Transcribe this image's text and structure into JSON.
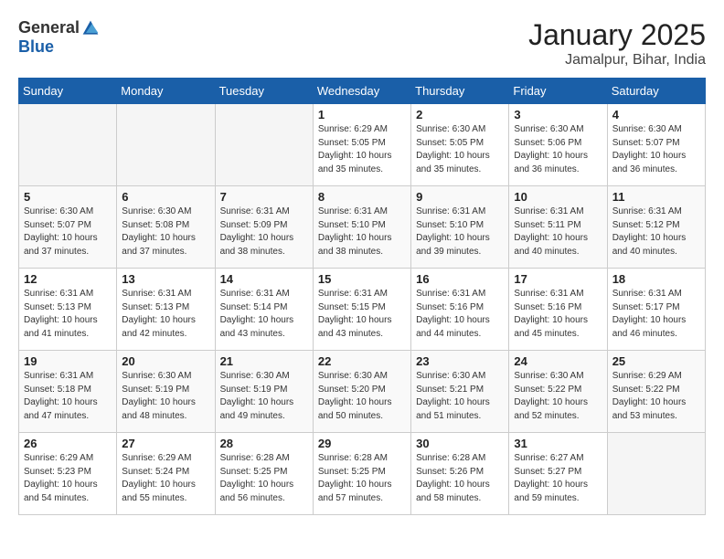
{
  "header": {
    "logo_general": "General",
    "logo_blue": "Blue",
    "title": "January 2025",
    "subtitle": "Jamalpur, Bihar, India"
  },
  "days_of_week": [
    "Sunday",
    "Monday",
    "Tuesday",
    "Wednesday",
    "Thursday",
    "Friday",
    "Saturday"
  ],
  "weeks": [
    [
      {
        "day": "",
        "info": ""
      },
      {
        "day": "",
        "info": ""
      },
      {
        "day": "",
        "info": ""
      },
      {
        "day": "1",
        "info": "Sunrise: 6:29 AM\nSunset: 5:05 PM\nDaylight: 10 hours\nand 35 minutes."
      },
      {
        "day": "2",
        "info": "Sunrise: 6:30 AM\nSunset: 5:05 PM\nDaylight: 10 hours\nand 35 minutes."
      },
      {
        "day": "3",
        "info": "Sunrise: 6:30 AM\nSunset: 5:06 PM\nDaylight: 10 hours\nand 36 minutes."
      },
      {
        "day": "4",
        "info": "Sunrise: 6:30 AM\nSunset: 5:07 PM\nDaylight: 10 hours\nand 36 minutes."
      }
    ],
    [
      {
        "day": "5",
        "info": "Sunrise: 6:30 AM\nSunset: 5:07 PM\nDaylight: 10 hours\nand 37 minutes."
      },
      {
        "day": "6",
        "info": "Sunrise: 6:30 AM\nSunset: 5:08 PM\nDaylight: 10 hours\nand 37 minutes."
      },
      {
        "day": "7",
        "info": "Sunrise: 6:31 AM\nSunset: 5:09 PM\nDaylight: 10 hours\nand 38 minutes."
      },
      {
        "day": "8",
        "info": "Sunrise: 6:31 AM\nSunset: 5:10 PM\nDaylight: 10 hours\nand 38 minutes."
      },
      {
        "day": "9",
        "info": "Sunrise: 6:31 AM\nSunset: 5:10 PM\nDaylight: 10 hours\nand 39 minutes."
      },
      {
        "day": "10",
        "info": "Sunrise: 6:31 AM\nSunset: 5:11 PM\nDaylight: 10 hours\nand 40 minutes."
      },
      {
        "day": "11",
        "info": "Sunrise: 6:31 AM\nSunset: 5:12 PM\nDaylight: 10 hours\nand 40 minutes."
      }
    ],
    [
      {
        "day": "12",
        "info": "Sunrise: 6:31 AM\nSunset: 5:13 PM\nDaylight: 10 hours\nand 41 minutes."
      },
      {
        "day": "13",
        "info": "Sunrise: 6:31 AM\nSunset: 5:13 PM\nDaylight: 10 hours\nand 42 minutes."
      },
      {
        "day": "14",
        "info": "Sunrise: 6:31 AM\nSunset: 5:14 PM\nDaylight: 10 hours\nand 43 minutes."
      },
      {
        "day": "15",
        "info": "Sunrise: 6:31 AM\nSunset: 5:15 PM\nDaylight: 10 hours\nand 43 minutes."
      },
      {
        "day": "16",
        "info": "Sunrise: 6:31 AM\nSunset: 5:16 PM\nDaylight: 10 hours\nand 44 minutes."
      },
      {
        "day": "17",
        "info": "Sunrise: 6:31 AM\nSunset: 5:16 PM\nDaylight: 10 hours\nand 45 minutes."
      },
      {
        "day": "18",
        "info": "Sunrise: 6:31 AM\nSunset: 5:17 PM\nDaylight: 10 hours\nand 46 minutes."
      }
    ],
    [
      {
        "day": "19",
        "info": "Sunrise: 6:31 AM\nSunset: 5:18 PM\nDaylight: 10 hours\nand 47 minutes."
      },
      {
        "day": "20",
        "info": "Sunrise: 6:30 AM\nSunset: 5:19 PM\nDaylight: 10 hours\nand 48 minutes."
      },
      {
        "day": "21",
        "info": "Sunrise: 6:30 AM\nSunset: 5:19 PM\nDaylight: 10 hours\nand 49 minutes."
      },
      {
        "day": "22",
        "info": "Sunrise: 6:30 AM\nSunset: 5:20 PM\nDaylight: 10 hours\nand 50 minutes."
      },
      {
        "day": "23",
        "info": "Sunrise: 6:30 AM\nSunset: 5:21 PM\nDaylight: 10 hours\nand 51 minutes."
      },
      {
        "day": "24",
        "info": "Sunrise: 6:30 AM\nSunset: 5:22 PM\nDaylight: 10 hours\nand 52 minutes."
      },
      {
        "day": "25",
        "info": "Sunrise: 6:29 AM\nSunset: 5:22 PM\nDaylight: 10 hours\nand 53 minutes."
      }
    ],
    [
      {
        "day": "26",
        "info": "Sunrise: 6:29 AM\nSunset: 5:23 PM\nDaylight: 10 hours\nand 54 minutes."
      },
      {
        "day": "27",
        "info": "Sunrise: 6:29 AM\nSunset: 5:24 PM\nDaylight: 10 hours\nand 55 minutes."
      },
      {
        "day": "28",
        "info": "Sunrise: 6:28 AM\nSunset: 5:25 PM\nDaylight: 10 hours\nand 56 minutes."
      },
      {
        "day": "29",
        "info": "Sunrise: 6:28 AM\nSunset: 5:25 PM\nDaylight: 10 hours\nand 57 minutes."
      },
      {
        "day": "30",
        "info": "Sunrise: 6:28 AM\nSunset: 5:26 PM\nDaylight: 10 hours\nand 58 minutes."
      },
      {
        "day": "31",
        "info": "Sunrise: 6:27 AM\nSunset: 5:27 PM\nDaylight: 10 hours\nand 59 minutes."
      },
      {
        "day": "",
        "info": ""
      }
    ]
  ]
}
